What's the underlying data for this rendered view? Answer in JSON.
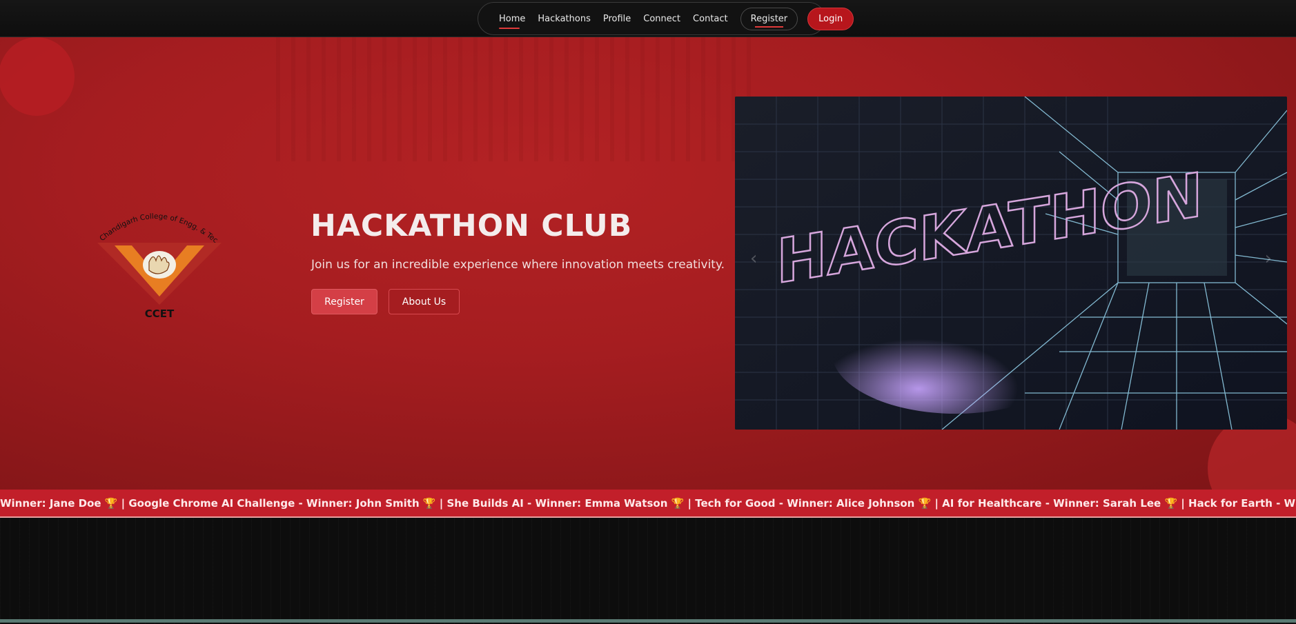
{
  "nav": {
    "items": [
      {
        "label": "Home",
        "active": true
      },
      {
        "label": "Hackathons"
      },
      {
        "label": "Profile"
      },
      {
        "label": "Connect"
      },
      {
        "label": "Contact"
      }
    ],
    "register_label": "Register",
    "login_label": "Login"
  },
  "hero": {
    "title": "HACKATHON CLUB",
    "subtitle": "Join us for an incredible experience where innovation meets creativity.",
    "register_button": "Register",
    "about_button": "About Us",
    "logo_arc_text": "Chandigarh College of Engg. & Tech.",
    "logo_text": "CCET",
    "carousel_image_text": "HACKATHON"
  },
  "ticker": {
    "text": "Winner: Jane Doe 🏆 | Google Chrome AI Challenge - Winner: John Smith 🏆 | She Builds AI - Winner: Emma Watson 🏆 | Tech for Good - Winner: Alice Johnson 🏆 | AI for Healthcare - Winner: Sarah Lee 🏆 | Hack for Earth - Winner: Noah Wilson 🏆 | Blockcha"
  },
  "colors": {
    "accent": "#b7161c",
    "hero_bg": "#a51d20",
    "ticker_bg": "#c21f2a"
  }
}
